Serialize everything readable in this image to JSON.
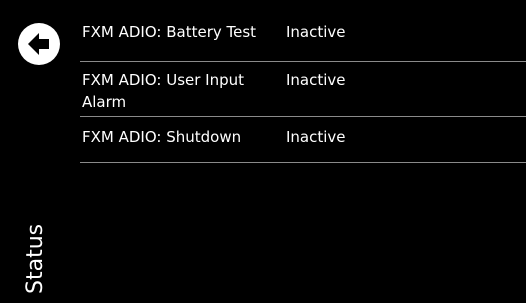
{
  "screen": {
    "title": "Status",
    "back_icon": "back-arrow-icon"
  },
  "colors": {
    "background": "#000000",
    "text": "#ffffff",
    "divider": "#8a8a8a"
  },
  "status_items": [
    {
      "name": "FXM ADIO: Battery Test",
      "state": "Inactive"
    },
    {
      "name": "FXM ADIO: User Input Alarm",
      "state": "Inactive"
    },
    {
      "name": "FXM ADIO: Shutdown",
      "state": "Inactive"
    }
  ]
}
